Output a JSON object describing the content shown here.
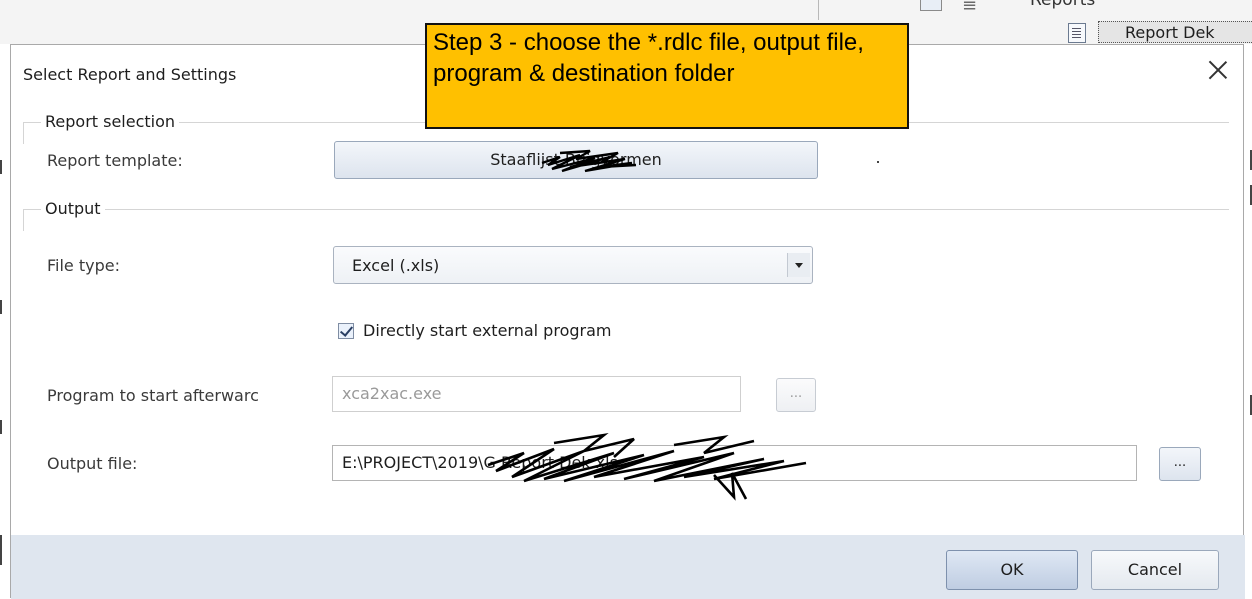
{
  "background": {
    "reports_label": "Reports",
    "report_tab_label": "Report Dek"
  },
  "dialog": {
    "title": "Select Report and Settings",
    "report_selection": {
      "group_label": "Report selection",
      "template_label": "Report template:",
      "template_value": "Staaflijst Buigvormen"
    },
    "output": {
      "group_label": "Output",
      "file_type_label": "File type:",
      "file_type_value": "Excel (.xls)",
      "start_program_label": "Directly start external program",
      "start_program_checked": true,
      "program_label": "Program to start afterwarc",
      "program_value": "xca2xac.exe",
      "program_browse_label": "...",
      "output_file_label": "Output file:",
      "output_file_value": "E:\\PROJECT\\2019\\G                                                  Report Dek.xls",
      "output_browse_label": "..."
    },
    "buttons": {
      "ok": "OK",
      "cancel": "Cancel"
    }
  },
  "callout": {
    "text": "Step 3 - choose the *.rdlc file, output file, program & destination folder"
  },
  "colors": {
    "callout_fill": "#ffc000",
    "footer": "#dfe6ef"
  }
}
